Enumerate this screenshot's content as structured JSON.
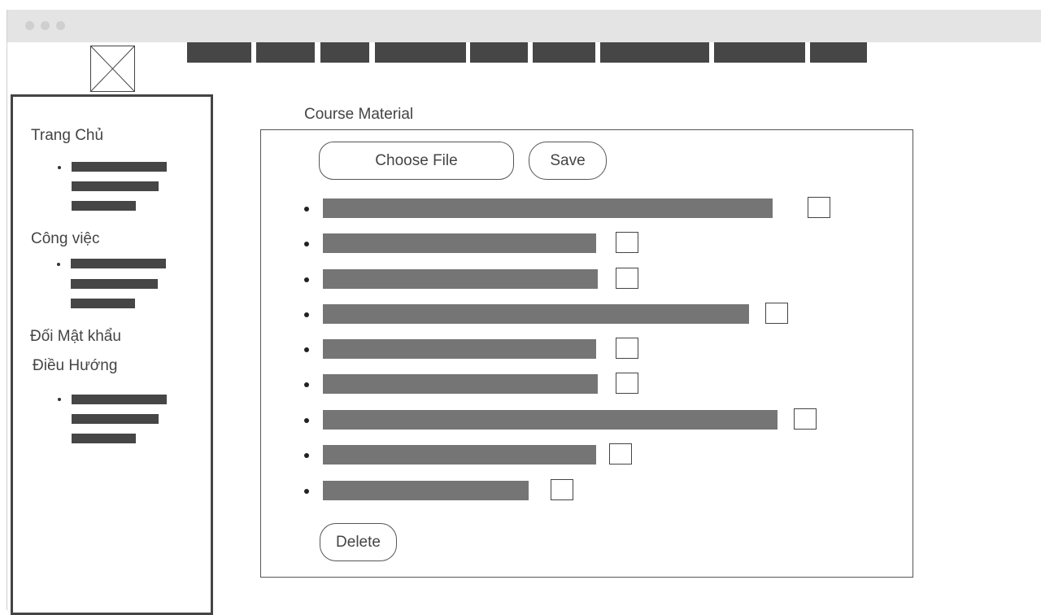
{
  "sidebar": {
    "sections": [
      {
        "label": "Trang Chủ"
      },
      {
        "label": "Công việc"
      },
      {
        "label": "Đối Mật khẩu"
      },
      {
        "label": "Điều Hướng"
      }
    ]
  },
  "main": {
    "section_title": "Course Material",
    "choose_file_label": "Choose File",
    "save_label": "Save",
    "delete_label": "Delete",
    "file_count": 9
  },
  "colors": {
    "titlebar": "#e4e4e4",
    "nav_placeholder": "#464646",
    "file_placeholder": "#757575",
    "border": "#444444"
  }
}
